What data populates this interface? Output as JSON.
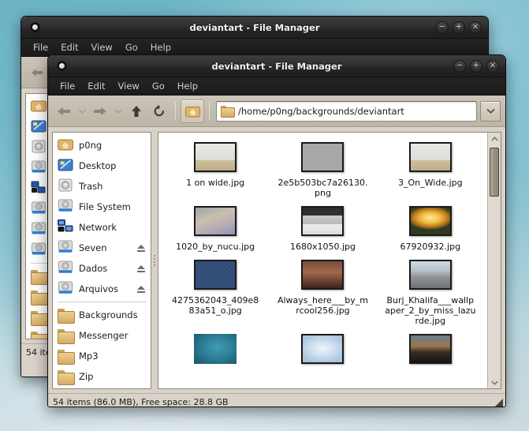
{
  "desktop": {
    "bg_top": "#6cb3c6",
    "bg_bottom": "#cdd9dd"
  },
  "windows": {
    "back": {
      "title": "deviantart - File Manager",
      "menus": [
        "File",
        "Edit",
        "View",
        "Go",
        "Help"
      ],
      "status": "54 ite",
      "buttons": {
        "minimize": "−",
        "maximize": "+",
        "close": "×"
      }
    },
    "front": {
      "title": "deviantart - File Manager",
      "menus": [
        "File",
        "Edit",
        "View",
        "Go",
        "Help"
      ],
      "buttons": {
        "minimize": "−",
        "maximize": "+",
        "close": "×"
      },
      "toolbar": {
        "back_label": "Back",
        "back_menu_label": "Back history",
        "forward_label": "Forward",
        "forward_menu_label": "Forward history",
        "up_label": "Open parent folder",
        "reload_label": "Reload",
        "home_label": "Home"
      },
      "path": {
        "value": "/home/p0ng/backgrounds/deviantart",
        "dropdown_label": "Path history"
      },
      "sidebar": [
        {
          "label": "p0ng",
          "icon": "home-folder-icon",
          "eject": false
        },
        {
          "label": "Desktop",
          "icon": "desktop-icon",
          "eject": false
        },
        {
          "label": "Trash",
          "icon": "trash-icon",
          "eject": false
        },
        {
          "label": "File System",
          "icon": "drive-icon",
          "eject": false
        },
        {
          "label": "Network",
          "icon": "network-icon",
          "eject": false
        },
        {
          "label": "Seven",
          "icon": "drive-icon",
          "eject": true
        },
        {
          "label": "Dados",
          "icon": "drive-icon",
          "eject": true
        },
        {
          "label": "Arquivos",
          "icon": "drive-icon",
          "eject": true
        },
        {
          "label": "Backgrounds",
          "icon": "folder-icon",
          "eject": false
        },
        {
          "label": "Messenger",
          "icon": "folder-icon",
          "eject": false
        },
        {
          "label": "Mp3",
          "icon": "folder-icon",
          "eject": false
        },
        {
          "label": "Zip",
          "icon": "folder-icon",
          "eject": false
        }
      ],
      "separator_after_index": 7,
      "files": [
        {
          "name": "1 on wide.jpg",
          "thumb": "wide-room"
        },
        {
          "name": "2e5b503bc7a26130.png",
          "thumb": "grey-birds"
        },
        {
          "name": "3_On_Wide.jpg",
          "thumb": "wide-room"
        },
        {
          "name": "1020_by_nucu.jpg",
          "thumb": "pastel-blur"
        },
        {
          "name": "1680x1050.jpg",
          "thumb": "dark-band-texture"
        },
        {
          "name": "67920932.jpg",
          "thumb": "golden-sunset"
        },
        {
          "name": "4275362043_409e883a51_o.jpg",
          "thumb": "navy-pattern"
        },
        {
          "name": "Always_here___by_mrcool256.jpg",
          "thumb": "sepia-bench"
        },
        {
          "name": "Burj_Khalifa___wallpaper_2_by_miss_lazurde.jpg",
          "thumb": "city-skyline"
        },
        {
          "name": "",
          "thumb": "teal-gradient"
        },
        {
          "name": "",
          "thumb": "light-blue-blur"
        },
        {
          "name": "",
          "thumb": "dark-silhouette"
        }
      ],
      "status": "54 items (86.0 MB), Free space: 28.8 GB",
      "scrollbar": {
        "up_label": "Scroll up",
        "down_label": "Scroll down"
      }
    }
  }
}
